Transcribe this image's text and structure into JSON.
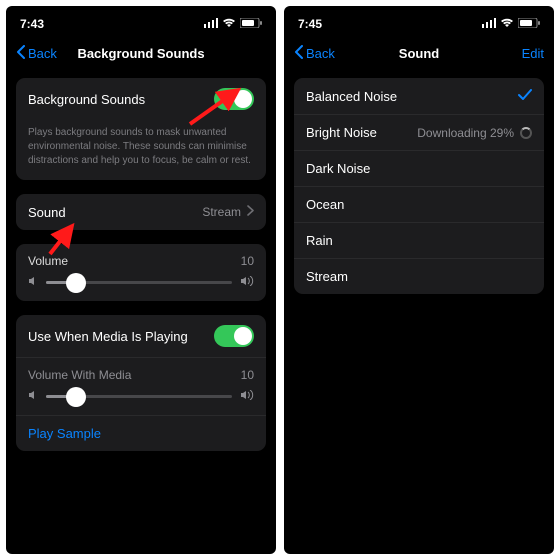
{
  "left": {
    "status_time": "7:43",
    "nav_back": "Back",
    "nav_title": "Background Sounds",
    "bg_sounds_label": "Background Sounds",
    "bg_sounds_desc": "Plays background sounds to mask unwanted environmental noise. These sounds can minimise distractions and help you to focus, be calm or rest.",
    "sound_label": "Sound",
    "sound_value": "Stream",
    "volume_label": "Volume",
    "volume_value": "10",
    "media_label": "Use When Media Is Playing",
    "media_volume_label": "Volume With Media",
    "media_volume_value": "10",
    "play_sample": "Play Sample"
  },
  "right": {
    "status_time": "7:45",
    "nav_back": "Back",
    "nav_title": "Sound",
    "nav_edit": "Edit",
    "items": {
      "0": {
        "label": "Balanced Noise"
      },
      "1": {
        "label": "Bright Noise",
        "status": "Downloading 29%"
      },
      "2": {
        "label": "Dark Noise"
      },
      "3": {
        "label": "Ocean"
      },
      "4": {
        "label": "Rain"
      },
      "5": {
        "label": "Stream"
      }
    }
  }
}
